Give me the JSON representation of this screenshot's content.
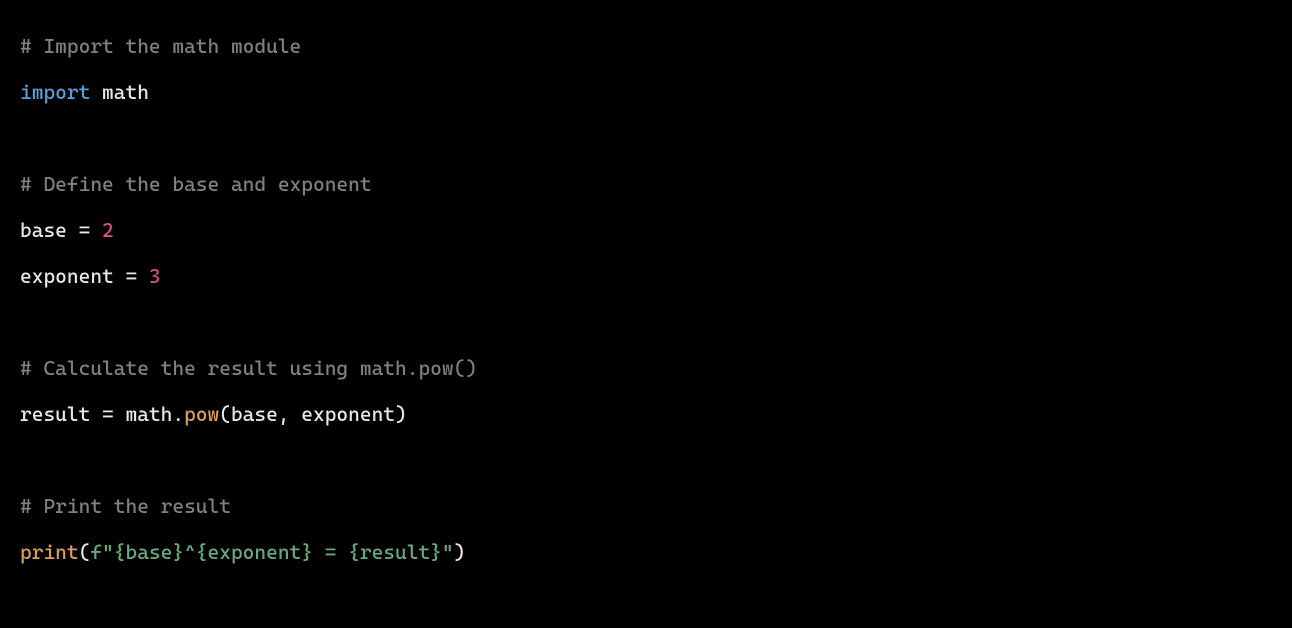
{
  "code": {
    "lines": [
      {
        "type": "comment",
        "tokens": [
          {
            "class": "comment",
            "text": "# Import the math module"
          }
        ]
      },
      {
        "type": "code",
        "tokens": [
          {
            "class": "keyword",
            "text": "import"
          },
          {
            "class": "default",
            "text": " math"
          }
        ]
      },
      {
        "type": "blank",
        "tokens": []
      },
      {
        "type": "comment",
        "tokens": [
          {
            "class": "comment",
            "text": "# Define the base and exponent"
          }
        ]
      },
      {
        "type": "code",
        "tokens": [
          {
            "class": "default",
            "text": "base = "
          },
          {
            "class": "number",
            "text": "2"
          }
        ]
      },
      {
        "type": "code",
        "tokens": [
          {
            "class": "default",
            "text": "exponent = "
          },
          {
            "class": "number",
            "text": "3"
          }
        ]
      },
      {
        "type": "blank",
        "tokens": []
      },
      {
        "type": "comment",
        "tokens": [
          {
            "class": "comment",
            "text": "# Calculate the result using math.pow()"
          }
        ]
      },
      {
        "type": "code",
        "tokens": [
          {
            "class": "default",
            "text": "result = math."
          },
          {
            "class": "function",
            "text": "pow"
          },
          {
            "class": "default",
            "text": "(base, exponent)"
          }
        ]
      },
      {
        "type": "blank",
        "tokens": []
      },
      {
        "type": "comment",
        "tokens": [
          {
            "class": "comment",
            "text": "# Print the result"
          }
        ]
      },
      {
        "type": "code",
        "tokens": [
          {
            "class": "builtin",
            "text": "print"
          },
          {
            "class": "default",
            "text": "("
          },
          {
            "class": "string",
            "text": "f\"{base}^{exponent} = {result}\""
          },
          {
            "class": "default",
            "text": ")"
          }
        ]
      }
    ]
  }
}
